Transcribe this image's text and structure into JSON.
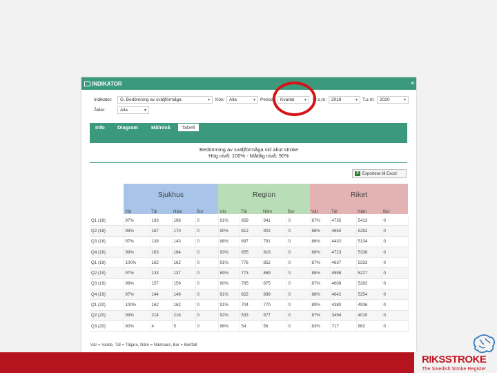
{
  "panel": {
    "title": "INDIKATOR",
    "close_glyph": "×"
  },
  "filters": {
    "indikator_label": "Indikator:",
    "indikator_value": "G. Bedömning av sväljförmåga",
    "kon_label": "Kön:",
    "kon_value": "Alla",
    "period_label": "Period:",
    "period_value": "Kvartal",
    "from_label": "Fr.o.m:",
    "from_value": "2018",
    "tom_label": "T.o.m:",
    "tom_value": "2020",
    "alder_label": "Ålder:",
    "alder_value": "Alla"
  },
  "tabs": [
    {
      "label": "Info",
      "active": false
    },
    {
      "label": "Diagram",
      "active": false
    },
    {
      "label": "Målnivå",
      "active": false
    },
    {
      "label": "Tabell",
      "active": true
    }
  ],
  "chart": {
    "title": "Bedömning av sväljförmåga vid akut stroke",
    "subtitle": "Hög nivå: 100% - Måttlig nivå: 90%"
  },
  "export_label": "Exportera till Excel",
  "groups": [
    "Sjukhus",
    "Region",
    "Riket"
  ],
  "columns": [
    "Vär",
    "Täl",
    "Näm",
    "Bor"
  ],
  "rows": [
    {
      "period": "Q1 (18)",
      "values": [
        "97%",
        "193",
        "198",
        "0",
        "91%",
        "859",
        "941",
        "0",
        "87%",
        "4735",
        "5413",
        "0"
      ]
    },
    {
      "period": "Q2 (18)",
      "values": [
        "98%",
        "167",
        "170",
        "0",
        "90%",
        "812",
        "902",
        "0",
        "88%",
        "4650",
        "5292",
        "0"
      ]
    },
    {
      "period": "Q3 (18)",
      "values": [
        "97%",
        "139",
        "143",
        "0",
        "88%",
        "697",
        "791",
        "0",
        "86%",
        "4432",
        "5134",
        "0"
      ]
    },
    {
      "period": "Q4 (18)",
      "values": [
        "99%",
        "163",
        "164",
        "0",
        "93%",
        "855",
        "916",
        "0",
        "88%",
        "4723",
        "5338",
        "0"
      ]
    },
    {
      "period": "Q1 (19)",
      "values": [
        "100%",
        "162",
        "162",
        "0",
        "91%",
        "776",
        "852",
        "0",
        "87%",
        "4637",
        "5333",
        "0"
      ]
    },
    {
      "period": "Q2 (19)",
      "values": [
        "97%",
        "133",
        "137",
        "0",
        "89%",
        "773",
        "869",
        "0",
        "88%",
        "4598",
        "5227",
        "0"
      ]
    },
    {
      "period": "Q3 (19)",
      "values": [
        "99%",
        "157",
        "159",
        "0",
        "90%",
        "785",
        "875",
        "0",
        "87%",
        "4608",
        "5283",
        "0"
      ]
    },
    {
      "period": "Q4 (19)",
      "values": [
        "97%",
        "144",
        "149",
        "0",
        "91%",
        "822",
        "899",
        "0",
        "88%",
        "4642",
        "5254",
        "0"
      ]
    },
    {
      "period": "Q1 (20)",
      "values": [
        "100%",
        "162",
        "162",
        "0",
        "91%",
        "704",
        "770",
        "0",
        "89%",
        "4380",
        "4936",
        "0"
      ]
    },
    {
      "period": "Q2 (20)",
      "values": [
        "99%",
        "214",
        "216",
        "0",
        "92%",
        "533",
        "577",
        "0",
        "87%",
        "3494",
        "4010",
        "0"
      ]
    },
    {
      "period": "Q3 (20)",
      "values": [
        "80%",
        "4",
        "5",
        "0",
        "96%",
        "54",
        "56",
        "0",
        "83%",
        "717",
        "863",
        "0"
      ]
    }
  ],
  "footnote": "Vär = Värde, Täl = Täljare, Näm = Nämnare, Bor = Bortfall",
  "logo": {
    "title": "RIKSSTROKE",
    "subtitle": "The Swedish Stroke Register"
  },
  "colors": {
    "header_green": "#3b9a7e",
    "sjukhus_blue": "#a8c4e8",
    "region_green": "#b9ddb7",
    "riket_red": "#e3b3b3",
    "footer_red": "#b5131d",
    "annotation_red": "#d51418"
  }
}
